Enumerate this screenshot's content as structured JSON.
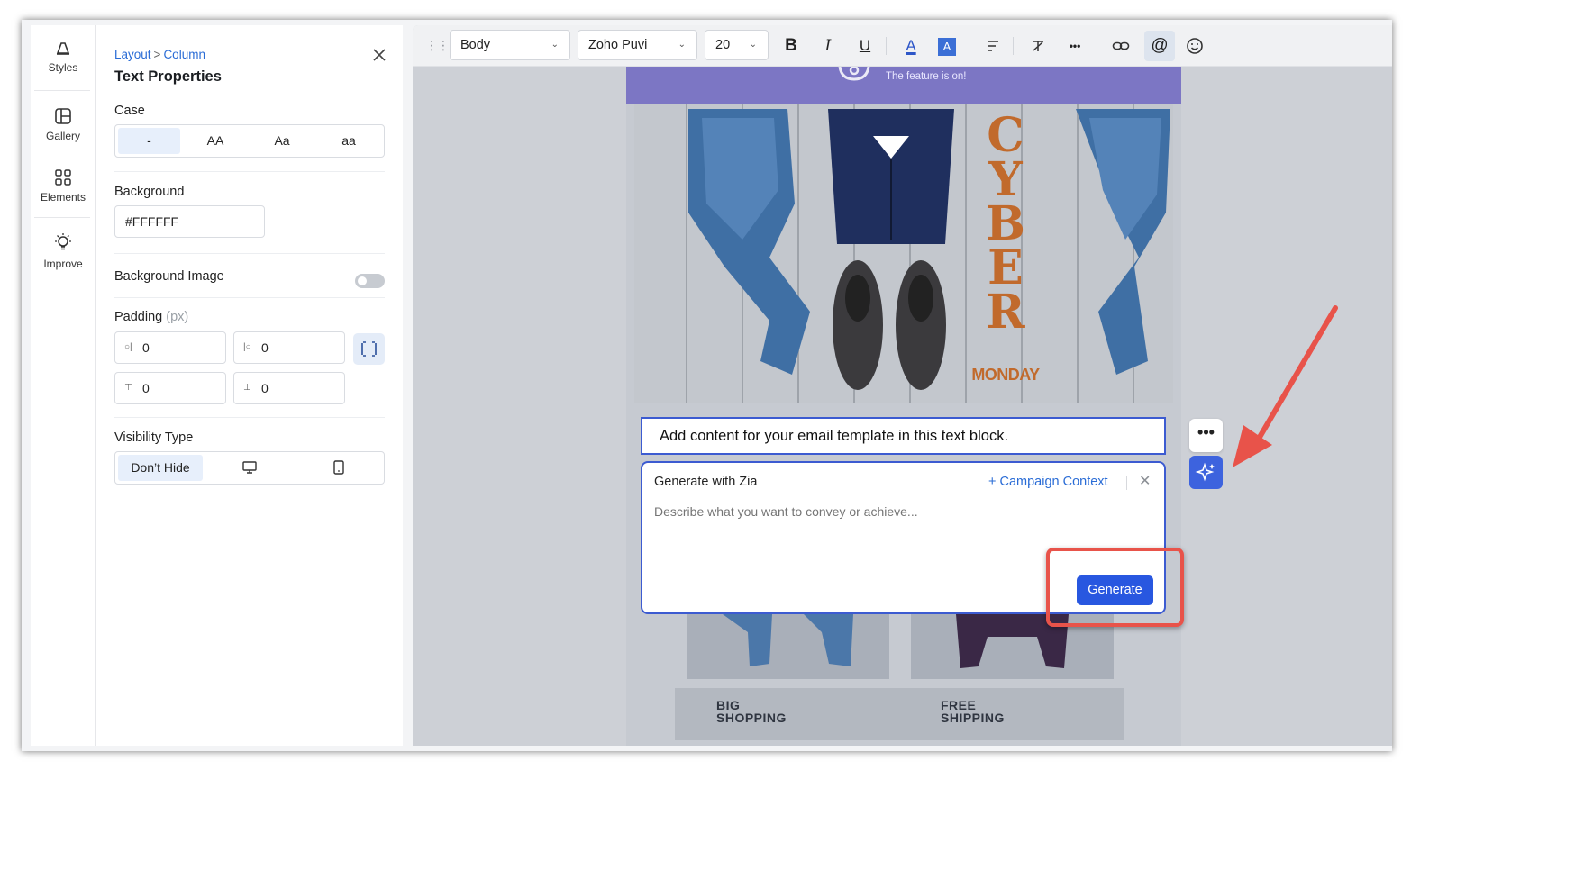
{
  "rail": {
    "items": [
      {
        "label": "Styles",
        "icon": "paint-brush-icon"
      },
      {
        "label": "Gallery",
        "icon": "gallery-icon"
      },
      {
        "label": "Elements",
        "icon": "elements-grid-icon"
      },
      {
        "label": "Improve",
        "icon": "lightbulb-icon"
      }
    ]
  },
  "panel": {
    "breadcrumb": [
      "Layout",
      "Column"
    ],
    "breadcrumb_sep": ">",
    "title": "Text Properties",
    "case": {
      "label": "Case",
      "options": [
        "-",
        "AA",
        "Aa",
        "aa"
      ],
      "selected": "-"
    },
    "background": {
      "label": "Background",
      "value": "#FFFFFF"
    },
    "background_image": {
      "label": "Background Image",
      "enabled": false
    },
    "padding": {
      "label": "Padding",
      "unit": "(px)",
      "left": "0",
      "right": "0",
      "top": "0",
      "bottom": "0"
    },
    "visibility": {
      "label": "Visibility Type",
      "options": [
        "Don’t Hide",
        "desktop-icon",
        "mobile-icon"
      ],
      "selected": "Don’t Hide"
    }
  },
  "toolbar": {
    "style_select": "Body",
    "font_select": "Zoho Puvi",
    "size_select": "20",
    "buttons": [
      "bold-icon",
      "italic-icon",
      "underline-icon",
      "font-color-icon",
      "highlight-color-icon",
      "align-icon",
      "clear-format-icon",
      "more-icon",
      "link-icon",
      "mention-icon",
      "emoji-icon"
    ],
    "bold": "B",
    "italic": "I",
    "underline": "U",
    "font_color": "A",
    "highlight": "A",
    "more": "•••",
    "mention": "@"
  },
  "email": {
    "banner_text": "The feature is on!",
    "hero_word": [
      "C",
      "Y",
      "B",
      "E",
      "R"
    ],
    "hero_sub": "MONDAY",
    "text_block": "Add content for your email template in this text block.",
    "promo_left": [
      "BIG",
      "SHOPPING"
    ],
    "promo_right": [
      "FREE",
      "SHIPPING"
    ]
  },
  "zia": {
    "title": "Generate with Zia",
    "context_link": "+ Campaign Context",
    "placeholder": "Describe what you want to convey or achieve...",
    "generate_label": "Generate"
  },
  "side": {
    "more": "•••"
  },
  "colors": {
    "accent": "#2857E0",
    "link": "#2A6CD6",
    "banner": "#7C76C4",
    "highlight": "#E8534A"
  }
}
